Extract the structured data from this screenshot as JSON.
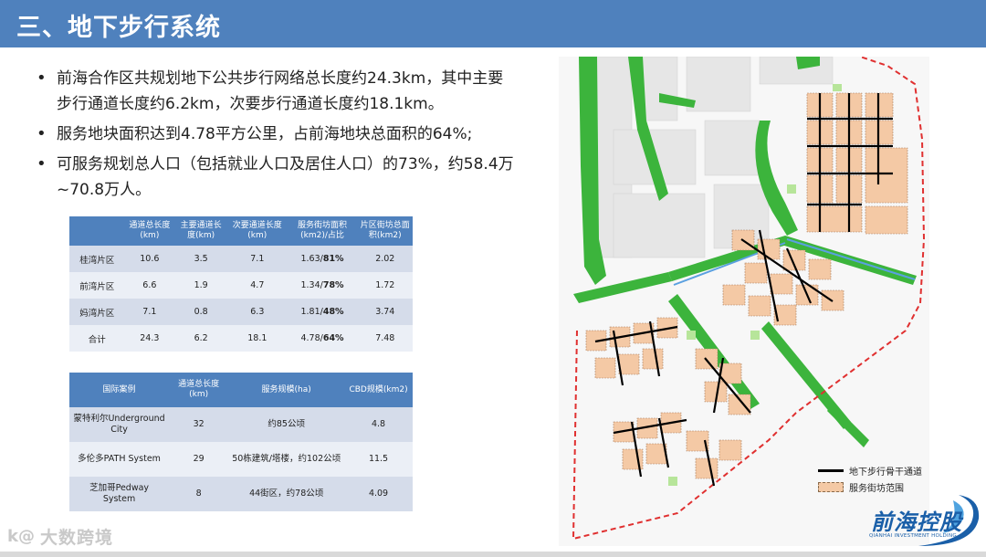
{
  "header": {
    "title": "三、地下步行系统"
  },
  "bullets": [
    "前海合作区共规划地下公共步行网络总长度约24.3km，其中主要步行通道长度约6.2km，次要步行通道长度约18.1km。",
    "服务地块面积达到4.78平方公里，占前海地块总面积的64%;",
    "可服务规划总人口（包括就业人口及居住人口）的73%，约58.4万~70.8万人。"
  ],
  "table1": {
    "headers": [
      "",
      "通道总长度(km)",
      "主要通道长度(km)",
      "次要通道长度(km)",
      "服务街坊面积(km2)/占比",
      "片区街坊总面积(km2)"
    ],
    "rows": [
      [
        "桂湾片区",
        "10.6",
        "3.5",
        "7.1",
        "1.63/",
        "81%",
        "2.02"
      ],
      [
        "前湾片区",
        "6.6",
        "1.9",
        "4.7",
        "1.34/",
        "78%",
        "1.72"
      ],
      [
        "妈湾片区",
        "7.1",
        "0.8",
        "6.3",
        "1.81/",
        "48%",
        "3.74"
      ],
      [
        "合计",
        "24.3",
        "6.2",
        "18.1",
        "4.78/",
        "64%",
        "7.48"
      ]
    ]
  },
  "table2": {
    "headers": [
      "国际案例",
      "通道总长度(km)",
      "服务规模(ha)",
      "CBD规模(km2)"
    ],
    "rows": [
      [
        "蒙特利尔Underground City",
        "32",
        "约85公顷",
        "4.8"
      ],
      [
        "多伦多PATH System",
        "29",
        "50栋建筑/塔楼，约102公顷",
        "11.5"
      ],
      [
        "芝加哥Pedway System",
        "8",
        "44街区，约78公顷",
        "4.09"
      ]
    ]
  },
  "legend": {
    "line_label": "地下步行骨干通道",
    "area_label": "服务街坊范围"
  },
  "logo": {
    "name": "前海控股",
    "sub": "QIANHAI INVESTMENT HOLDING"
  },
  "watermark": {
    "icon": "k@",
    "text": "大数跨境"
  },
  "colors": {
    "header": "#4f81bd",
    "green": "#3cb43c",
    "parcel": "#f4c9a5",
    "logo": "#1a5fa8"
  }
}
